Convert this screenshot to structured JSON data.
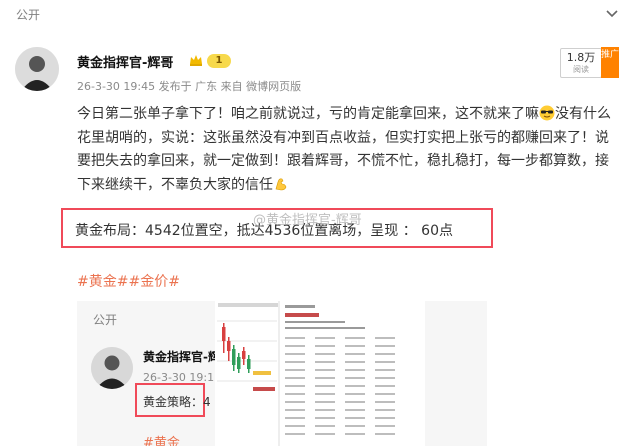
{
  "top": {
    "visibility": "公开"
  },
  "author": {
    "name": "黄金指挥官-辉哥",
    "level": "1",
    "time": "26-3-30 19:45",
    "location": "发布于 广东",
    "source_prefix": "来自",
    "source": "微博网页版"
  },
  "stats": {
    "reads": "1.8万",
    "reads_label": "阅读",
    "promote": "推广"
  },
  "post": {
    "part1": "今日第二张单子拿下了！咱之前就说过，亏的肯定能拿回来，这不就来了嘛",
    "part2": "没有什么花里胡哨的，实说：这张虽然没有冲到百点收益，但实打实把上张亏的都赚回来了！说要把失去的拿回来，就一定做到！跟着辉哥，不慌不忙，稳扎稳打，每一步都算数，接下来继续干，不辜负大家的信任",
    "highlight": "黄金布局：4542位置空，抵达4536位置离场，呈现 ： 60点",
    "watermark": "@黄金指挥官-辉哥",
    "tags": "#黄金##金价#"
  },
  "embedded": {
    "visibility": "公开",
    "name": "黄金指挥官-辉哥",
    "time": "26-3-30 19:1",
    "strategy": "黄金策略：4",
    "tags": "#黄金"
  },
  "icons": [
    "chevron-down-icon",
    "crown-icon",
    "sunglasses-emoji-icon",
    "flexed-arm-emoji-icon"
  ],
  "colors": {
    "highlight_border": "#f04a59",
    "tag": "#eb7350",
    "promote": "#ff8200",
    "level_badge": "#f7d94c"
  }
}
